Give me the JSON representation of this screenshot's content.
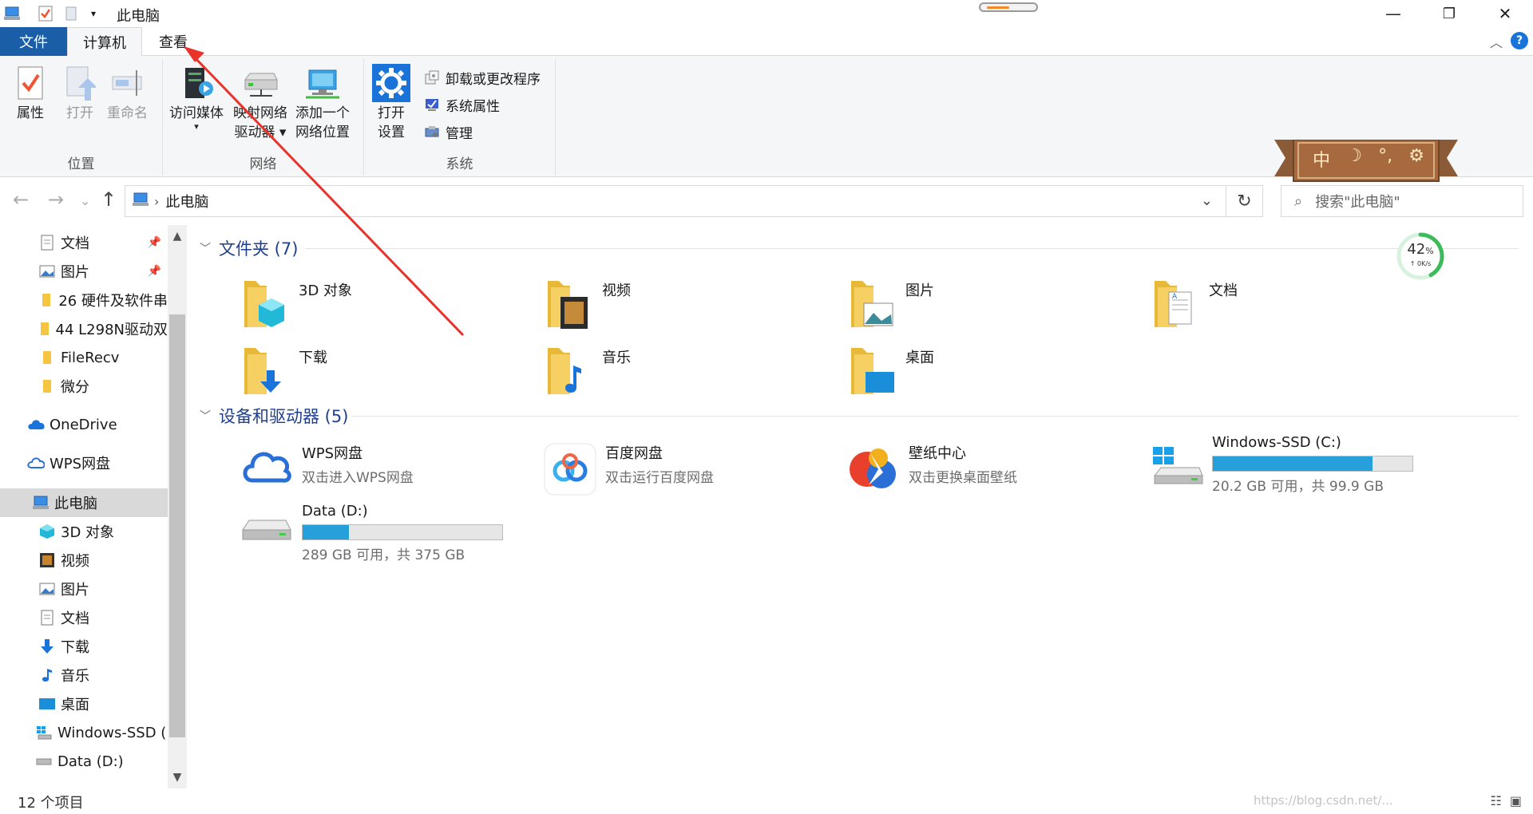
{
  "window": {
    "title": "此电脑",
    "minimize": "—",
    "maximize": "❐",
    "close": "✕"
  },
  "ribbon_tabs": [
    {
      "label": "文件"
    },
    {
      "label": "计算机"
    },
    {
      "label": "查看"
    }
  ],
  "help_label": "?",
  "collapse_label": "︿",
  "ribbon": {
    "location": {
      "label": "位置",
      "buttons": [
        {
          "label": "属性"
        },
        {
          "label": "打开"
        },
        {
          "label": "重命名"
        }
      ]
    },
    "network": {
      "label": "网络",
      "buttons": [
        {
          "label1": "访问媒体",
          "label2": "▾"
        },
        {
          "label1": "映射网络",
          "label2": "驱动器 ▾"
        },
        {
          "label1": "添加一个",
          "label2": "网络位置"
        }
      ]
    },
    "system": {
      "label": "系统",
      "open_settings": {
        "label1": "打开",
        "label2": "设置"
      },
      "small": [
        {
          "label": "卸载或更改程序"
        },
        {
          "label": "系统属性"
        },
        {
          "label": "管理"
        }
      ]
    }
  },
  "addressbar": {
    "back": "←",
    "forward": "→",
    "recent": "⌄",
    "up": "↑",
    "path": "此电脑",
    "sep": "›",
    "dropdown": "⌄",
    "refresh": "↻"
  },
  "search": {
    "icon": "⌕",
    "placeholder": "搜索\"此电脑\""
  },
  "skin_widget": {
    "chars": [
      "中",
      "☽",
      "°,",
      "⚙"
    ]
  },
  "navpane": {
    "items": [
      {
        "label": "文档",
        "pin": "📌"
      },
      {
        "label": "图片",
        "pin": "📌"
      },
      {
        "label": "26 硬件及软件串"
      },
      {
        "label": "44 L298N驱动双"
      },
      {
        "label": "FileRecv"
      },
      {
        "label": "微分"
      },
      {
        "label": "OneDrive"
      },
      {
        "label": "WPS网盘"
      },
      {
        "label": "此电脑"
      },
      {
        "label": "3D 对象"
      },
      {
        "label": "视频"
      },
      {
        "label": "图片"
      },
      {
        "label": "文档"
      },
      {
        "label": "下载"
      },
      {
        "label": "音乐"
      },
      {
        "label": "桌面"
      },
      {
        "label": "Windows-SSD ("
      },
      {
        "label": "Data (D:)"
      }
    ],
    "scroll_up": "▲",
    "scroll_down": "▼"
  },
  "folders_group": {
    "title": "文件夹 (7)",
    "chevron": "﹀"
  },
  "folders": [
    {
      "name": "3D 对象"
    },
    {
      "name": "视频"
    },
    {
      "name": "图片"
    },
    {
      "name": "文档"
    },
    {
      "name": "下载"
    },
    {
      "name": "音乐"
    },
    {
      "name": "桌面"
    }
  ],
  "devices_group": {
    "title": "设备和驱动器 (5)",
    "chevron": "﹀"
  },
  "devices": [
    {
      "name": "WPS网盘",
      "sub": "双击进入WPS网盘"
    },
    {
      "name": "百度网盘",
      "sub": "双击运行百度网盘"
    },
    {
      "name": "壁纸中心",
      "sub": "双击更换桌面壁纸"
    },
    {
      "name": "Windows-SSD (C:)",
      "sub": "20.2 GB 可用，共 99.9 GB",
      "used_fraction": 0.8
    },
    {
      "name": "Data (D:)",
      "sub": "289 GB 可用，共 375 GB",
      "used_fraction": 0.23
    }
  ],
  "speed_widget": {
    "percent": "42",
    "unit": "%",
    "rate": "↑ 0K/s",
    "fraction": 0.42
  },
  "status": {
    "count": "12 个项目",
    "watermark": "https://blog.csdn.net/..."
  },
  "colors": {
    "accent": "#1a5ea8",
    "bar": "#26a0da",
    "annotation": "#e8322a"
  }
}
